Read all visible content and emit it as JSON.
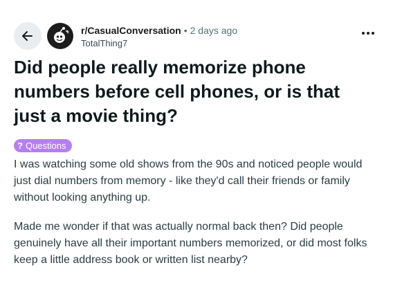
{
  "post": {
    "subreddit": "r/CasualConversation",
    "separator": "•",
    "time_ago": "2 days ago",
    "author": "TotalThing7",
    "title": "Did people really memorize phone numbers before cell phones, or is that just a movie thing?",
    "flair": {
      "icon_text": "?",
      "label": "Questions"
    },
    "paragraphs": [
      "I was watching some old shows from the 90s and noticed people would just dial numbers from memory - like they'd call their friends or family without looking anything up.",
      "Made me wonder if that was actually normal back then? Did people genuinely have all their important numbers memorized, or did most folks keep a little address book or written list nearby?"
    ]
  },
  "icons": {
    "back": "back-arrow-icon",
    "avatar": "subreddit-avatar-icon",
    "more": "more-options-icon",
    "flair": "question-mark-icon"
  },
  "colors": {
    "flair_background": "#b57ff0",
    "back_button_background": "#eaedef",
    "meta_text": "#576f76"
  }
}
